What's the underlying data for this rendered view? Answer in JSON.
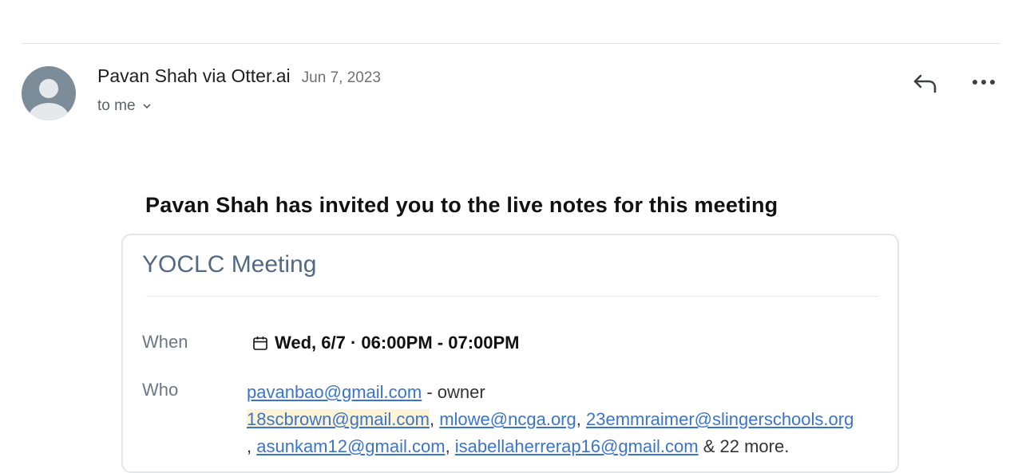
{
  "email": {
    "sender": "Pavan Shah via Otter.ai",
    "date": "Jun 7, 2023",
    "recipient": "to me",
    "icons": [
      "avatar",
      "chevron-down-icon",
      "reply-icon",
      "more-options-icon",
      "calendar-icon"
    ]
  },
  "body": {
    "heading": "Pavan Shah has invited you to the live notes for this meeting",
    "meeting": {
      "title": "YOCLC Meeting",
      "when_label": "When",
      "when_value": "Wed, 6/7 · 06:00PM - 07:00PM",
      "who_label": "Who",
      "owner_email": "pavanbao@gmail.com",
      "owner_suffix": " - owner",
      "participants": [
        "18scbrown@gmail.com",
        "mlowe@ncga.org",
        "23emmraimer@slingerschools.org",
        "asunkam12@gmail.com",
        "isabellaherrerap16@gmail.com"
      ],
      "separator": ", ",
      "line_lead": ", ",
      "more_text": " & 22 more."
    }
  },
  "colors": {
    "link": "#3b74c8",
    "meeting_title": "#536a84",
    "avatar": "#7c8d99",
    "highlight": "#fdf4d8"
  }
}
